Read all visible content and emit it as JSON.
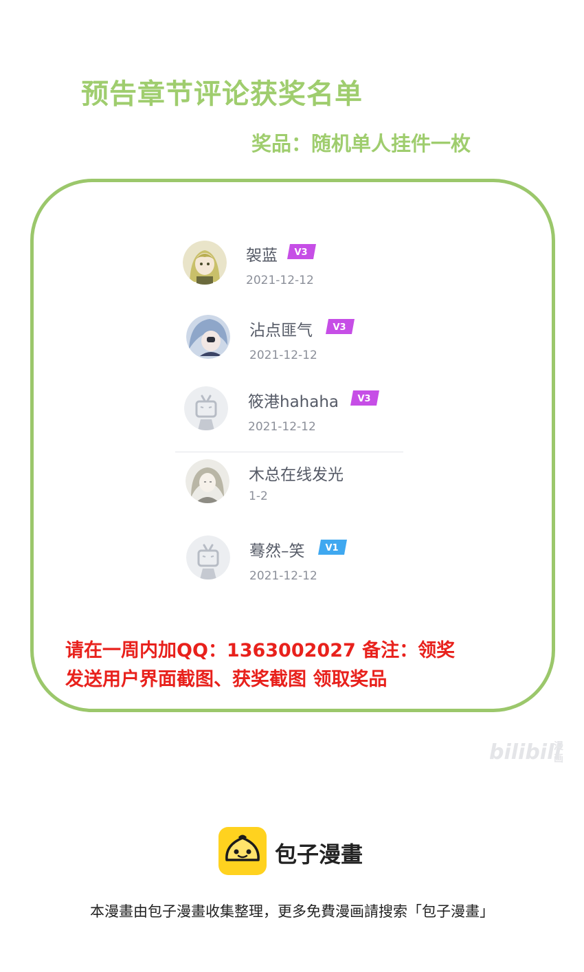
{
  "header": {
    "title": "预告章节评论获奖名单",
    "prize": "奖品：随机单人挂件一枚"
  },
  "winners": [
    {
      "name": "袈蓝",
      "date": "2021-12-12",
      "level": "V3",
      "avatar": "anime-avatar-blonde"
    },
    {
      "name": "沾点匪气",
      "date": "2021-12-12",
      "level": "V3",
      "avatar": "anime-avatar-bluehair"
    },
    {
      "name": "筱港hahaha",
      "date": "2021-12-12",
      "level": "V3",
      "avatar": "default-tv-avatar"
    },
    {
      "name": "木总在线发光",
      "date": "1-2",
      "level": "",
      "avatar": "anime-avatar-sketch"
    },
    {
      "name": "蓦然–笑",
      "date": "2021-12-12",
      "level": "V1",
      "avatar": "default-tv-avatar"
    }
  ],
  "notice": {
    "line1": "请在一周内加QQ：1363002027  备注：领奖",
    "line2": "发送用户界面截图、获奖截图  领取奖品"
  },
  "watermark": {
    "text": "bilibili",
    "sub": "漫画"
  },
  "footer": {
    "brand": "包子漫畫",
    "text": "本漫畫由包子漫畫收集整理，更多免費漫画請搜索「包子漫畫」"
  },
  "colors": {
    "accent_green": "#9fcd6e",
    "notice_red": "#e8211c",
    "badge_v3": "#c64ee6",
    "badge_v1": "#3fa8f0"
  }
}
